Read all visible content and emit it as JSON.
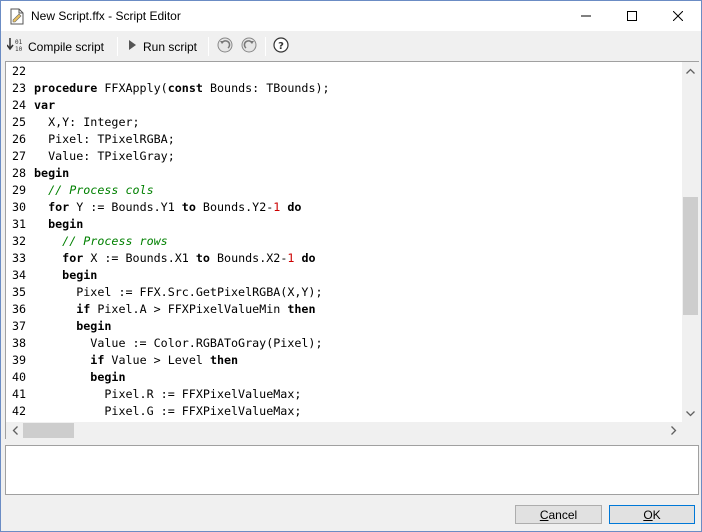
{
  "window": {
    "title": "New Script.ffx - Script Editor"
  },
  "toolbar": {
    "compile_label": "Compile script",
    "run_label": "Run script"
  },
  "editor": {
    "lines": [
      {
        "num": "22",
        "segments": []
      },
      {
        "num": "23",
        "segments": [
          {
            "t": "procedure ",
            "c": "kw"
          },
          {
            "t": "FFXApply(",
            "c": ""
          },
          {
            "t": "const ",
            "c": "kw"
          },
          {
            "t": "Bounds: TBounds);",
            "c": ""
          }
        ]
      },
      {
        "num": "24",
        "segments": [
          {
            "t": "var",
            "c": "kw"
          }
        ]
      },
      {
        "num": "25",
        "segments": [
          {
            "t": "  X,Y: Integer;",
            "c": ""
          }
        ]
      },
      {
        "num": "26",
        "segments": [
          {
            "t": "  Pixel: TPixelRGBA;",
            "c": ""
          }
        ]
      },
      {
        "num": "27",
        "segments": [
          {
            "t": "  Value: TPixelGray;",
            "c": ""
          }
        ]
      },
      {
        "num": "28",
        "segments": [
          {
            "t": "begin",
            "c": "kw"
          }
        ]
      },
      {
        "num": "29",
        "segments": [
          {
            "t": "  ",
            "c": ""
          },
          {
            "t": "// Process cols",
            "c": "cm"
          }
        ]
      },
      {
        "num": "30",
        "segments": [
          {
            "t": "  ",
            "c": ""
          },
          {
            "t": "for ",
            "c": "kw"
          },
          {
            "t": "Y := Bounds.Y1 ",
            "c": ""
          },
          {
            "t": "to ",
            "c": "kw"
          },
          {
            "t": "Bounds.Y2-",
            "c": ""
          },
          {
            "t": "1",
            "c": "num"
          },
          {
            "t": " ",
            "c": ""
          },
          {
            "t": "do",
            "c": "kw"
          }
        ]
      },
      {
        "num": "31",
        "segments": [
          {
            "t": "  ",
            "c": ""
          },
          {
            "t": "begin",
            "c": "kw"
          }
        ]
      },
      {
        "num": "32",
        "segments": [
          {
            "t": "    ",
            "c": ""
          },
          {
            "t": "// Process rows",
            "c": "cm"
          }
        ]
      },
      {
        "num": "33",
        "segments": [
          {
            "t": "    ",
            "c": ""
          },
          {
            "t": "for ",
            "c": "kw"
          },
          {
            "t": "X := Bounds.X1 ",
            "c": ""
          },
          {
            "t": "to ",
            "c": "kw"
          },
          {
            "t": "Bounds.X2-",
            "c": ""
          },
          {
            "t": "1",
            "c": "num"
          },
          {
            "t": " ",
            "c": ""
          },
          {
            "t": "do",
            "c": "kw"
          }
        ]
      },
      {
        "num": "34",
        "segments": [
          {
            "t": "    ",
            "c": ""
          },
          {
            "t": "begin",
            "c": "kw"
          }
        ]
      },
      {
        "num": "35",
        "segments": [
          {
            "t": "      Pixel := FFX.Src.GetPixelRGBA(X,Y);",
            "c": ""
          }
        ]
      },
      {
        "num": "36",
        "segments": [
          {
            "t": "      ",
            "c": ""
          },
          {
            "t": "if ",
            "c": "kw"
          },
          {
            "t": "Pixel.A > FFXPixelValueMin ",
            "c": ""
          },
          {
            "t": "then",
            "c": "kw"
          }
        ]
      },
      {
        "num": "37",
        "segments": [
          {
            "t": "      ",
            "c": ""
          },
          {
            "t": "begin",
            "c": "kw"
          }
        ]
      },
      {
        "num": "38",
        "segments": [
          {
            "t": "        Value := Color.RGBAToGray(Pixel);",
            "c": ""
          }
        ]
      },
      {
        "num": "39",
        "segments": [
          {
            "t": "        ",
            "c": ""
          },
          {
            "t": "if ",
            "c": "kw"
          },
          {
            "t": "Value > Level ",
            "c": ""
          },
          {
            "t": "then",
            "c": "kw"
          }
        ]
      },
      {
        "num": "40",
        "segments": [
          {
            "t": "        ",
            "c": ""
          },
          {
            "t": "begin",
            "c": "kw"
          }
        ]
      },
      {
        "num": "41",
        "segments": [
          {
            "t": "          Pixel.R := FFXPixelValueMax;",
            "c": ""
          }
        ]
      },
      {
        "num": "42",
        "segments": [
          {
            "t": "          Pixel.G := FFXPixelValueMax;",
            "c": ""
          }
        ]
      }
    ]
  },
  "buttons": {
    "cancel_label": "Cancel",
    "ok_label": "OK"
  },
  "colors": {
    "comment": "#008000",
    "number": "#cc0000"
  }
}
